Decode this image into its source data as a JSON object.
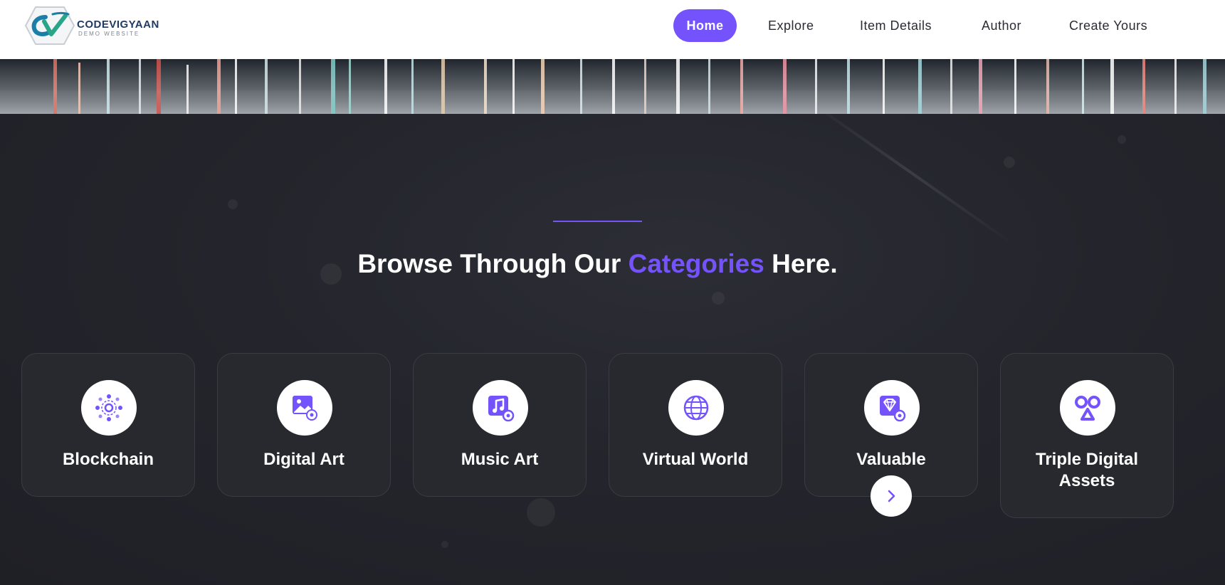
{
  "brand": {
    "name": "CODEVIGYAAN",
    "tagline": "DEMO WEBSITE",
    "logo_icon": "cv-logo-icon"
  },
  "nav": {
    "items": [
      {
        "label": "Home",
        "active": true
      },
      {
        "label": "Explore",
        "active": false
      },
      {
        "label": "Item Details",
        "active": false
      },
      {
        "label": "Author",
        "active": false
      },
      {
        "label": "Create Yours",
        "active": false
      }
    ]
  },
  "section": {
    "heading_before": "Browse Through Our ",
    "heading_highlight": "Categories",
    "heading_after": " Here."
  },
  "categories": [
    {
      "label": "Blockchain",
      "icon": "blockchain-icon"
    },
    {
      "label": "Digital Art",
      "icon": "digital-art-icon"
    },
    {
      "label": "Music Art",
      "icon": "music-art-icon"
    },
    {
      "label": "Virtual World",
      "icon": "globe-icon"
    },
    {
      "label": "Valuable",
      "icon": "diamond-icon"
    },
    {
      "label": "Triple Digital Assets",
      "icon": "triple-shapes-icon"
    }
  ],
  "carousel": {
    "next_icon": "chevron-right-icon"
  },
  "colors": {
    "accent": "#7453fc",
    "background": "#22232a",
    "card": "#27292e",
    "header": "#ffffff"
  }
}
